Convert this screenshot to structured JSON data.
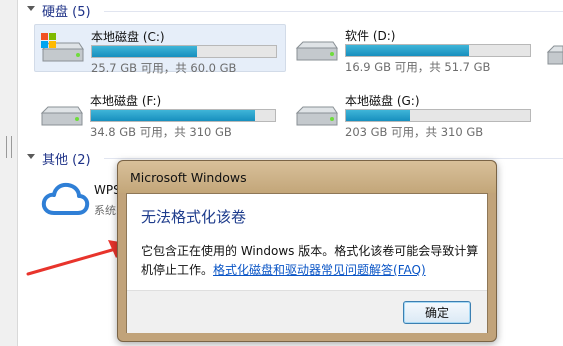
{
  "groups": {
    "hard_disks": {
      "label": "硬盘 (5)"
    },
    "other": {
      "label": "其他 (2)"
    }
  },
  "drives": [
    {
      "name": "本地磁盘 (C:)",
      "info": "25.7 GB 可用，共 60.0 GB",
      "used_fraction": 0.57,
      "selected": true
    },
    {
      "name": "软件 (D:)",
      "info": "16.9 GB 可用，共 51.7 GB",
      "used_fraction": 0.67
    },
    {
      "name": "本地磁盘 (F:)",
      "info": "34.8 GB 可用，共 310 GB",
      "used_fraction": 0.89
    },
    {
      "name": "本地磁盘 (G:)",
      "info": "203 GB 可用，共 310 GB",
      "used_fraction": 0.35
    }
  ],
  "other_items": [
    {
      "name": "WPS",
      "sub": "系统"
    }
  ],
  "dialog": {
    "title": "Microsoft Windows",
    "heading": "无法格式化该卷",
    "message": "它包含正在使用的 Windows 版本。格式化该卷可能会导致计算机停止工作。",
    "link": "格式化磁盘和驱动器常见问题解答(FAQ)",
    "ok_label": "确定"
  },
  "colors": {
    "bar_fill": "#178fbe",
    "group_label": "#1e3287",
    "dialog_heading": "#1e3c8c",
    "link": "#0a55c6",
    "arrow": "#e8342c"
  }
}
